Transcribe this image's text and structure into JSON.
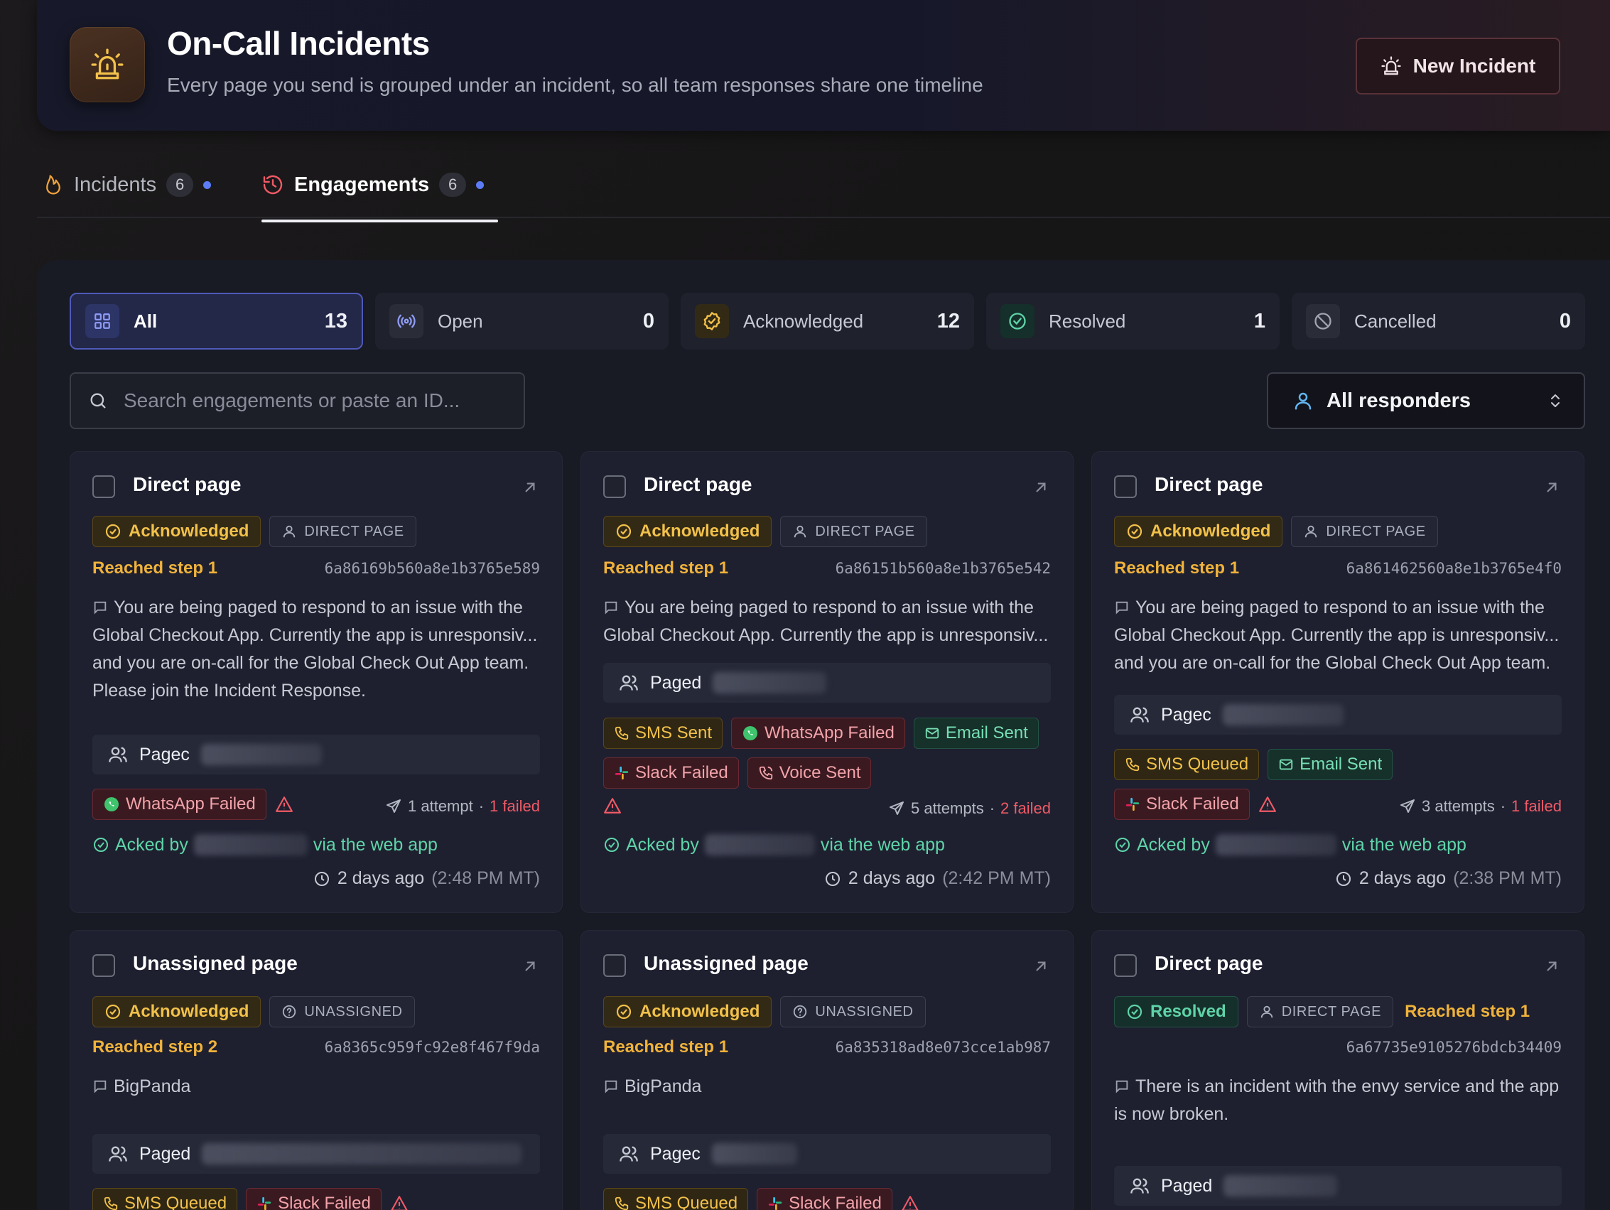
{
  "header": {
    "title": "On-Call Incidents",
    "subtitle": "Every page you send is grouped under an incident, so all team responses share one timeline",
    "new_incident_label": "New Incident"
  },
  "tabs": [
    {
      "label": "Incidents",
      "count": "6",
      "active": false
    },
    {
      "label": "Engagements",
      "count": "6",
      "active": true
    }
  ],
  "filters": [
    {
      "label": "All",
      "count": "13",
      "icon": "grid-icon",
      "active": true
    },
    {
      "label": "Open",
      "count": "0",
      "icon": "broadcast-icon",
      "active": false
    },
    {
      "label": "Acknowledged",
      "count": "12",
      "icon": "badge-check-icon",
      "active": false
    },
    {
      "label": "Resolved",
      "count": "1",
      "icon": "check-circle-icon",
      "active": false
    },
    {
      "label": "Cancelled",
      "count": "0",
      "icon": "ban-icon",
      "active": false
    }
  ],
  "search": {
    "placeholder": "Search engagements or paste an ID..."
  },
  "responders": {
    "label": "All responders"
  },
  "colors": {
    "accent": "#5b7cf4",
    "acknowledged": "#f2c14a",
    "resolved": "#5fd4a8",
    "failed": "#f05a66",
    "new_incident_border": "#5a3238"
  },
  "cards": [
    {
      "title": "Direct page",
      "status": "Acknowledged",
      "type": "DIRECT PAGE",
      "step": "Reached step 1",
      "id": "6a86169b560a8e1b3765e589",
      "message": "You are being paged to respond to an issue with the Global Checkout App. Currently the app is unresponsiv... and you are on-call for the Global Check Out App team. Please join the Incident Response.",
      "paged_label": "Pagec",
      "channels": [
        {
          "label": "WhatsApp Failed",
          "kind": "fail",
          "icon": "whatsapp-icon"
        }
      ],
      "attempts": "1 attempt",
      "failed": "1 failed",
      "acked_prefix": "Acked by",
      "acked_suffix": "via the web app",
      "ago": "2 days ago",
      "time": "(2:48 PM MT)"
    },
    {
      "title": "Direct page",
      "status": "Acknowledged",
      "type": "DIRECT PAGE",
      "step": "Reached step 1",
      "id": "6a86151b560a8e1b3765e542",
      "message": "You are being paged to respond to an issue with the Global Checkout App. Currently the app is unresponsiv...",
      "paged_label": "Paged",
      "channels": [
        {
          "label": "SMS Sent",
          "kind": "warn",
          "icon": "phone-icon"
        },
        {
          "label": "WhatsApp Failed",
          "kind": "fail",
          "icon": "whatsapp-icon"
        },
        {
          "label": "Email Sent",
          "kind": "ok",
          "icon": "mail-icon"
        },
        {
          "label": "Slack Failed",
          "kind": "fail",
          "icon": "slack-icon"
        },
        {
          "label": "Voice Sent",
          "kind": "fail",
          "icon": "voice-icon"
        }
      ],
      "attempts": "5 attempts",
      "failed": "2 failed",
      "acked_prefix": "Acked by",
      "acked_suffix": "via the web app",
      "ago": "2 days ago",
      "time": "(2:42 PM MT)"
    },
    {
      "title": "Direct page",
      "status": "Acknowledged",
      "type": "DIRECT PAGE",
      "step": "Reached step 1",
      "id": "6a861462560a8e1b3765e4f0",
      "message": "You are being paged to respond to an issue with the Global Checkout App. Currently the app is unresponsiv... and you are on-call for the Global Check Out App team.",
      "paged_label": "Pagec",
      "channels": [
        {
          "label": "SMS Queued",
          "kind": "warn",
          "icon": "phone-icon"
        },
        {
          "label": "Email Sent",
          "kind": "ok",
          "icon": "mail-icon"
        },
        {
          "label": "Slack Failed",
          "kind": "fail",
          "icon": "slack-icon"
        }
      ],
      "attempts": "3 attempts",
      "failed": "1 failed",
      "acked_prefix": "Acked by",
      "acked_suffix": "via the web app",
      "ago": "2 days ago",
      "time": "(2:38 PM MT)"
    },
    {
      "title": "Unassigned page",
      "status": "Acknowledged",
      "type": "UNASSIGNED",
      "step": "Reached step 2",
      "id": "6a8365c959fc92e8f467f9da",
      "message": "BigPanda",
      "paged_label": "Paged",
      "channels": [
        {
          "label": "SMS Queued",
          "kind": "warn",
          "icon": "phone-icon"
        },
        {
          "label": "Slack Failed",
          "kind": "fail",
          "icon": "slack-icon"
        }
      ]
    },
    {
      "title": "Unassigned page",
      "status": "Acknowledged",
      "type": "UNASSIGNED",
      "step": "Reached step 1",
      "id": "6a835318ad8e073cce1ab987",
      "message": "BigPanda",
      "paged_label": "Pagec",
      "channels": [
        {
          "label": "SMS Queued",
          "kind": "warn",
          "icon": "phone-icon"
        },
        {
          "label": "Slack Failed",
          "kind": "fail",
          "icon": "slack-icon"
        }
      ]
    },
    {
      "title": "Direct page",
      "status": "Resolved",
      "type": "DIRECT PAGE",
      "step": "Reached step 1",
      "id": "6a67735e9105276bdcb34409",
      "message": "There is an incident with the envy service and the app is now broken.",
      "paged_label": "Paged",
      "channels": []
    }
  ]
}
